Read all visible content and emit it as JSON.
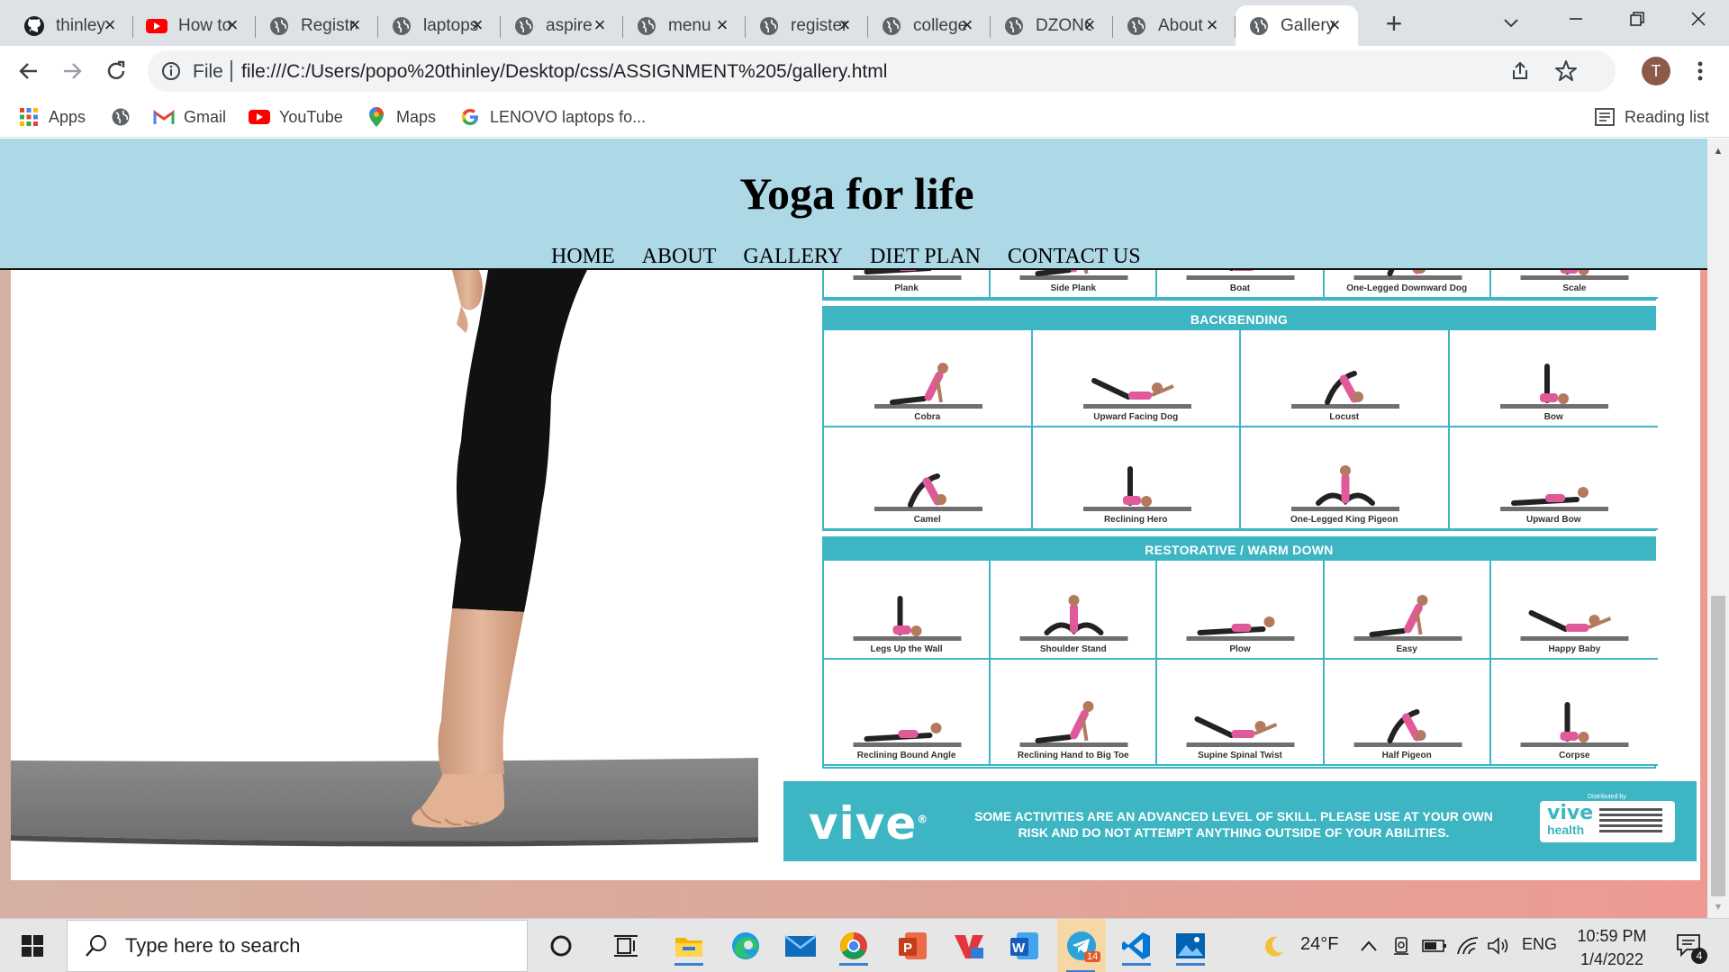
{
  "browser": {
    "tabs": [
      {
        "title": "thinley",
        "icon": "github-icon"
      },
      {
        "title": "How to",
        "icon": "youtube-icon"
      },
      {
        "title": "Registration",
        "icon": "globe-icon"
      },
      {
        "title": "laptops",
        "icon": "globe-icon"
      },
      {
        "title": "aspire",
        "icon": "globe-icon"
      },
      {
        "title": "menu",
        "icon": "globe-icon"
      },
      {
        "title": "register",
        "icon": "globe-icon"
      },
      {
        "title": "college",
        "icon": "globe-icon"
      },
      {
        "title": "DZONGKHAG",
        "icon": "globe-icon"
      },
      {
        "title": "About",
        "icon": "globe-icon"
      },
      {
        "title": "Gallery",
        "icon": "globe-icon",
        "active": true
      }
    ],
    "new_tab_label": "+",
    "file_label": "File",
    "url": "file:///C:/Users/popo%20thinley/Desktop/css/ASSIGNMENT%205/gallery.html",
    "avatar_letter": "T",
    "bookmarks": [
      {
        "label": "Apps",
        "icon": "apps-grid-icon"
      },
      {
        "label": "",
        "icon": "globe-icon"
      },
      {
        "label": "Gmail",
        "icon": "gmail-icon"
      },
      {
        "label": "YouTube",
        "icon": "youtube-icon"
      },
      {
        "label": "Maps",
        "icon": "maps-pin-icon"
      },
      {
        "label": "LENOVO laptops fo...",
        "icon": "google-icon"
      }
    ],
    "reading_list_label": "Reading list"
  },
  "page": {
    "site_title": "Yoga for life",
    "nav": [
      "HOME",
      "ABOUT",
      "GALLERY",
      "DIET PLAN",
      "CONTACT US"
    ],
    "colors": {
      "header_bg": "#add8e6",
      "accent_teal": "#3db5c3"
    }
  },
  "yoga_chart": {
    "top_row": [
      "Plank",
      "Side Plank",
      "Boat",
      "One-Legged Downward Dog",
      "Scale"
    ],
    "backbending_title": "BACKBENDING",
    "backbending_row1": [
      "Cobra",
      "Upward Facing Dog",
      "Locust",
      "Bow"
    ],
    "backbending_row2": [
      "Camel",
      "Reclining Hero",
      "One-Legged King Pigeon",
      "Upward Bow"
    ],
    "restorative_title": "RESTORATIVE / WARM DOWN",
    "restorative_row1": [
      "Legs Up the Wall",
      "Shoulder Stand",
      "Plow",
      "Easy",
      "Happy Baby"
    ],
    "restorative_row2": [
      "Reclining Bound Angle",
      "Reclining Hand to Big Toe",
      "Supine Spinal Twist",
      "Half Pigeon",
      "Corpse"
    ],
    "brand": "vive",
    "notice": "SOME ACTIVITIES ARE AN ADVANCED LEVEL OF SKILL. PLEASE USE AT YOUR OWN RISK AND DO NOT ATTEMPT ANYTHING OUTSIDE OF YOUR ABILITIES.",
    "card_brand": "vive",
    "card_sub": "health",
    "distributed_by": "Distributed by"
  },
  "taskbar": {
    "search_placeholder": "Type here to search",
    "weather": "24°F",
    "language": "ENG",
    "time": "10:59 PM",
    "date": "1/4/2022",
    "notification_count": "4",
    "telegram_badge": "14",
    "apps": [
      "cortana-icon",
      "task-view-icon",
      "file-explorer-icon",
      "edge-icon",
      "mail-icon",
      "chrome-icon",
      "powerpoint-icon",
      "vivaldi-icon",
      "word-icon",
      "telegram-icon",
      "vscode-icon",
      "photos-icon"
    ]
  }
}
